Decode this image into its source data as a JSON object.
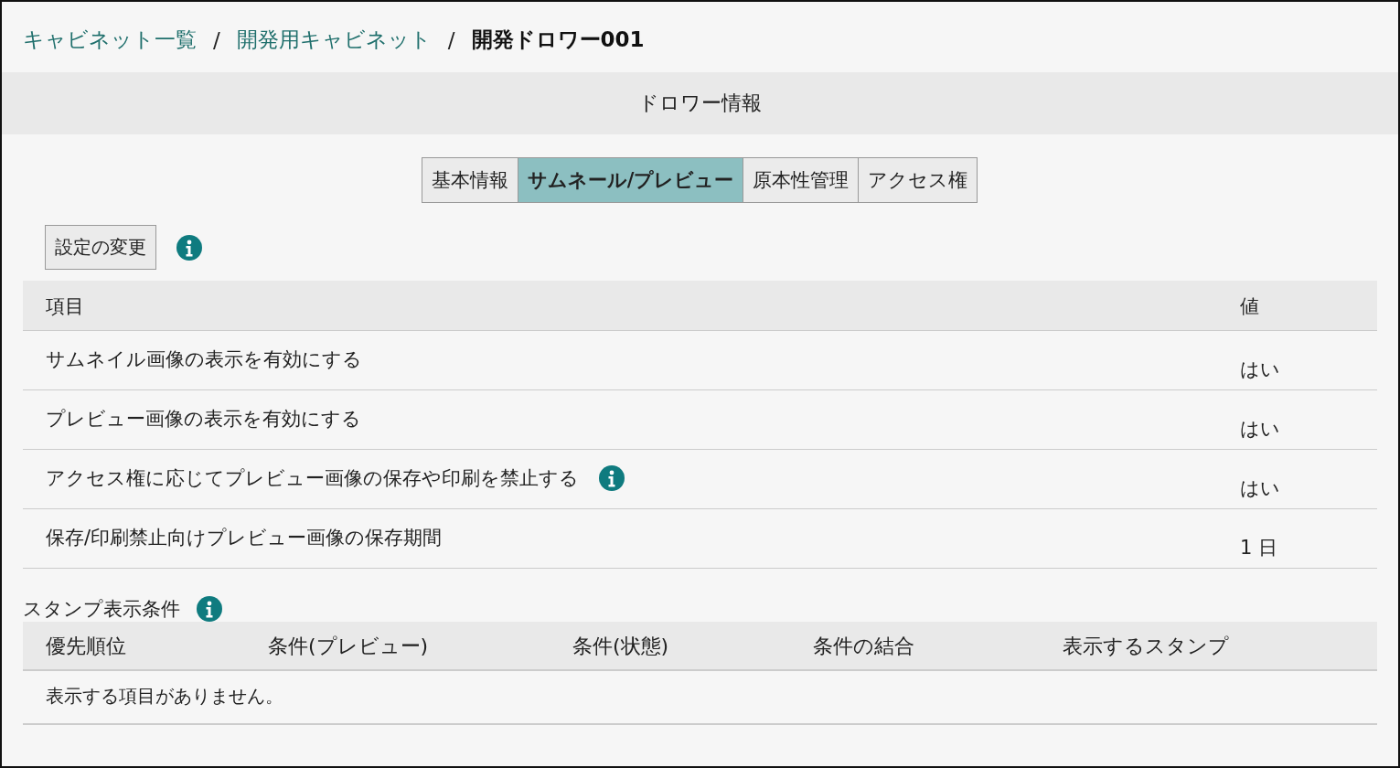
{
  "breadcrumb": [
    {
      "label": "キャビネット一覧",
      "kind": "link"
    },
    {
      "label": "開発用キャビネット",
      "kind": "link"
    },
    {
      "label": "開発ドロワー001",
      "kind": "current"
    }
  ],
  "breadcrumb_separator": "/",
  "panel_title": "ドロワー情報",
  "tabs": [
    {
      "label": "基本情報",
      "selected": false
    },
    {
      "label": "サムネール/プレビュー",
      "selected": true
    },
    {
      "label": "原本性管理",
      "selected": false
    },
    {
      "label": "アクセス権",
      "selected": false
    }
  ],
  "settings_button": {
    "label": "設定の変更",
    "info": true
  },
  "settings_table": {
    "columns": [
      "項目",
      "値"
    ],
    "rows": [
      {
        "item": "サムネイル画像の表示を有効にする",
        "value": "はい",
        "info": false
      },
      {
        "item": "プレビュー画像の表示を有効にする",
        "value": "はい",
        "info": false
      },
      {
        "item": "アクセス権に応じてプレビュー画像の保存や印刷を禁止する",
        "value": "はい",
        "info": true
      },
      {
        "item": "保存/印刷禁止向けプレビュー画像の保存期間",
        "value": "1 日",
        "info": false
      }
    ]
  },
  "stamp_section": {
    "title": "スタンプ表示条件",
    "info": true,
    "columns": [
      "優先順位",
      "条件(プレビュー)",
      "条件(状態)",
      "条件の結合",
      "表示するスタンプ"
    ],
    "empty_message": "表示する項目がありません。"
  }
}
